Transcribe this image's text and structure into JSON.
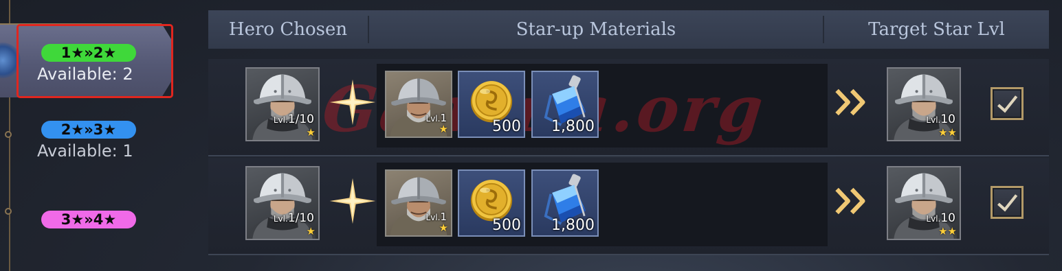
{
  "header": {
    "hero_chosen": "Hero Chosen",
    "star_up_materials": "Star-up Materials",
    "target_star_lvl": "Target Star Lvl"
  },
  "tiers": [
    {
      "label": "1★»2★",
      "available": "Available: 2",
      "color": "#3fd83a",
      "selected": true
    },
    {
      "label": "2★»3★",
      "available": "Available: 1",
      "color": "#3391f0",
      "selected": false
    },
    {
      "label": "3★»4★",
      "available": "",
      "color": "#f06ae8",
      "selected": false
    }
  ],
  "rows": [
    {
      "hero": {
        "lvl_prefix": "Lvl.",
        "lvl": "1/10",
        "stars": "★"
      },
      "material_hero": {
        "lvl_prefix": "Lvl.",
        "lvl": "1",
        "stars": "★"
      },
      "coin_amount": "500",
      "potion_amount": "1,800",
      "target": {
        "lvl_prefix": "Lvl.",
        "lvl": "10",
        "stars": "★★"
      },
      "checked": true
    },
    {
      "hero": {
        "lvl_prefix": "Lvl.",
        "lvl": "1/10",
        "stars": "★"
      },
      "material_hero": {
        "lvl_prefix": "Lvl.",
        "lvl": "1",
        "stars": "★"
      },
      "coin_amount": "500",
      "potion_amount": "1,800",
      "target": {
        "lvl_prefix": "Lvl.",
        "lvl": "10",
        "stars": "★★"
      },
      "checked": true
    }
  ],
  "watermark": "Gamula.org",
  "colors": {
    "highlight": "#e0261f",
    "gold": "#ffcf3a"
  }
}
